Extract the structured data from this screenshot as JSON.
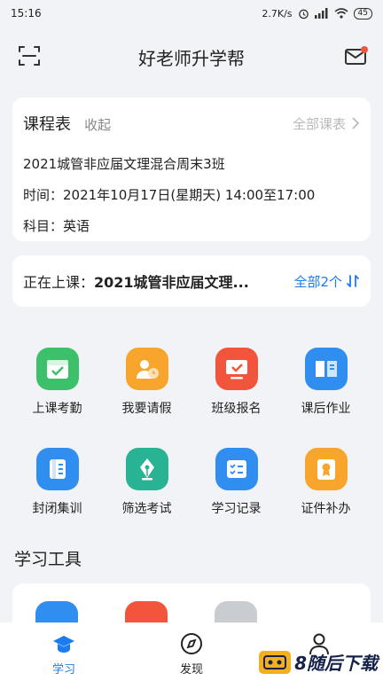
{
  "status": {
    "time": "15:16",
    "speed": "2.7K/s",
    "battery": "45"
  },
  "header": {
    "title": "好老师升学帮"
  },
  "schedule": {
    "title": "课程表",
    "collapse": "收起",
    "all_label": "全部课表",
    "class_name": "2021城管非应届文理混合周末3班",
    "time_line": "时间：2021年10月17日(星期天)  14:00至17:00",
    "subject_line": "科目：英语"
  },
  "live": {
    "prefix": "正在上课：",
    "course": "2021城管非应届文理...",
    "all_label": "全部2个"
  },
  "features": [
    {
      "label": "上课考勤",
      "color": "#3cc06a",
      "icon": "calendar-check-icon"
    },
    {
      "label": "我要请假",
      "color": "#f7a52d",
      "icon": "leave-icon"
    },
    {
      "label": "班级报名",
      "color": "#f2553b",
      "icon": "monitor-check-icon"
    },
    {
      "label": "课后作业",
      "color": "#2f8ef0",
      "icon": "book-icon"
    },
    {
      "label": "封闭集训",
      "color": "#2f8ef0",
      "icon": "notebook-icon"
    },
    {
      "label": "筛选考试",
      "color": "#27b394",
      "icon": "pen-nib-icon"
    },
    {
      "label": "学习记录",
      "color": "#2f8ef0",
      "icon": "record-icon"
    },
    {
      "label": "证件补办",
      "color": "#f7a52d",
      "icon": "certificate-icon"
    }
  ],
  "tools": {
    "title": "学习工具"
  },
  "tabs": [
    {
      "label": "学习",
      "icon": "graduation-cap-icon",
      "active": true
    },
    {
      "label": "发现",
      "icon": "compass-icon",
      "active": false
    },
    {
      "label": "",
      "icon": "profile-icon",
      "active": false
    }
  ],
  "watermark": {
    "text": "8随后下载"
  },
  "colors": {
    "accent": "#1a7cf0",
    "background": "#f1f3f6"
  }
}
